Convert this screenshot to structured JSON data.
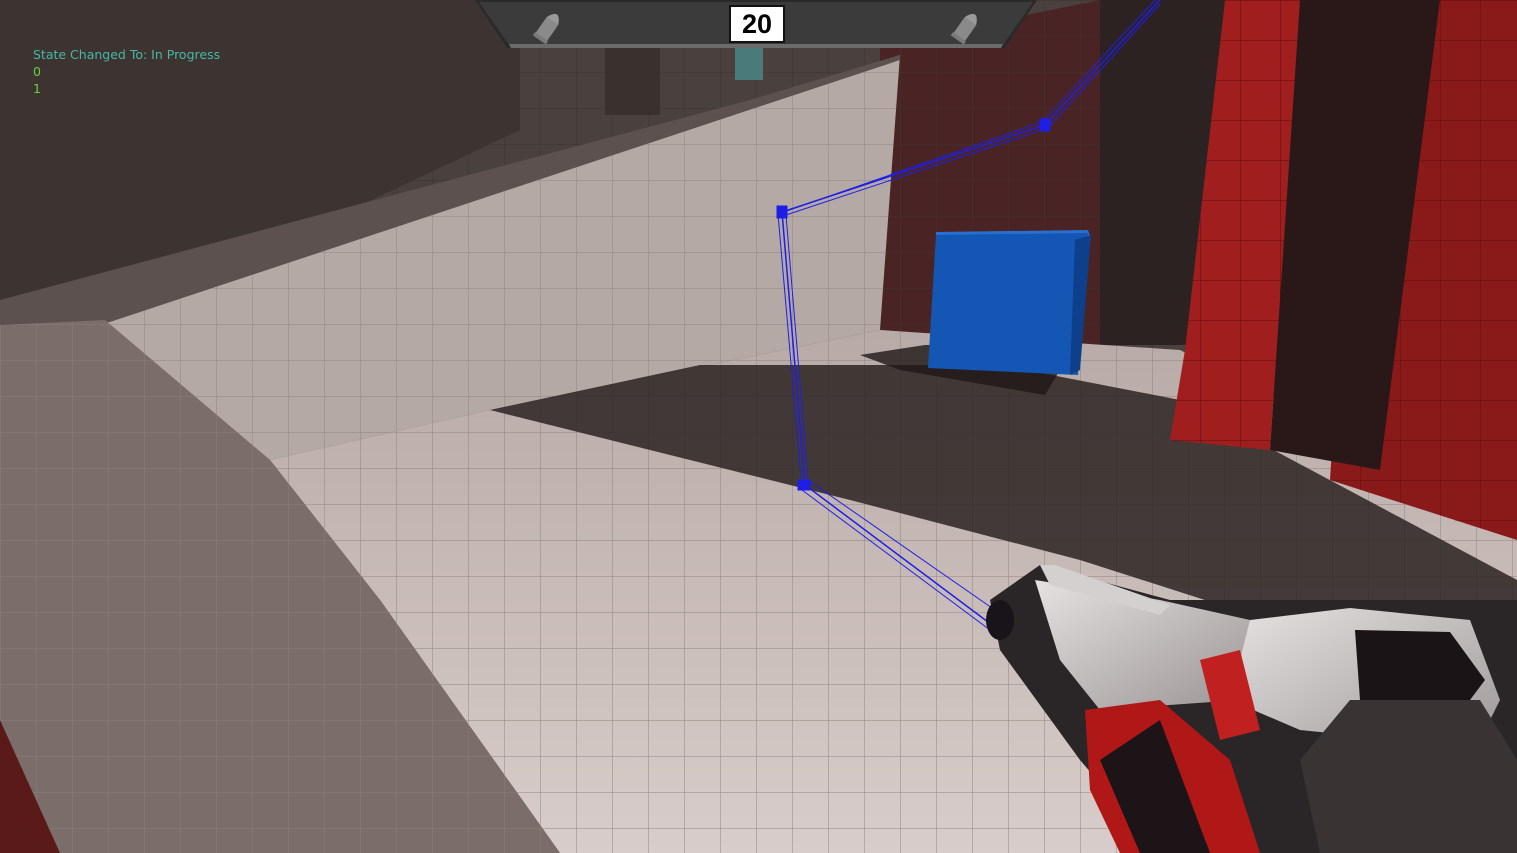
{
  "hud": {
    "ammo_count": "20",
    "left_icon": "bullet-icon",
    "right_icon": "bullet-icon"
  },
  "debug_log": {
    "state_message": "State Changed To: In Progress",
    "line_1": "0",
    "line_2": "1"
  },
  "colors": {
    "laser_trace": "#1e1ee6",
    "target_cube": "#1456b4",
    "wall_red": "#8a1414",
    "state_text": "#46b7a5",
    "number_text": "#63d23a"
  }
}
